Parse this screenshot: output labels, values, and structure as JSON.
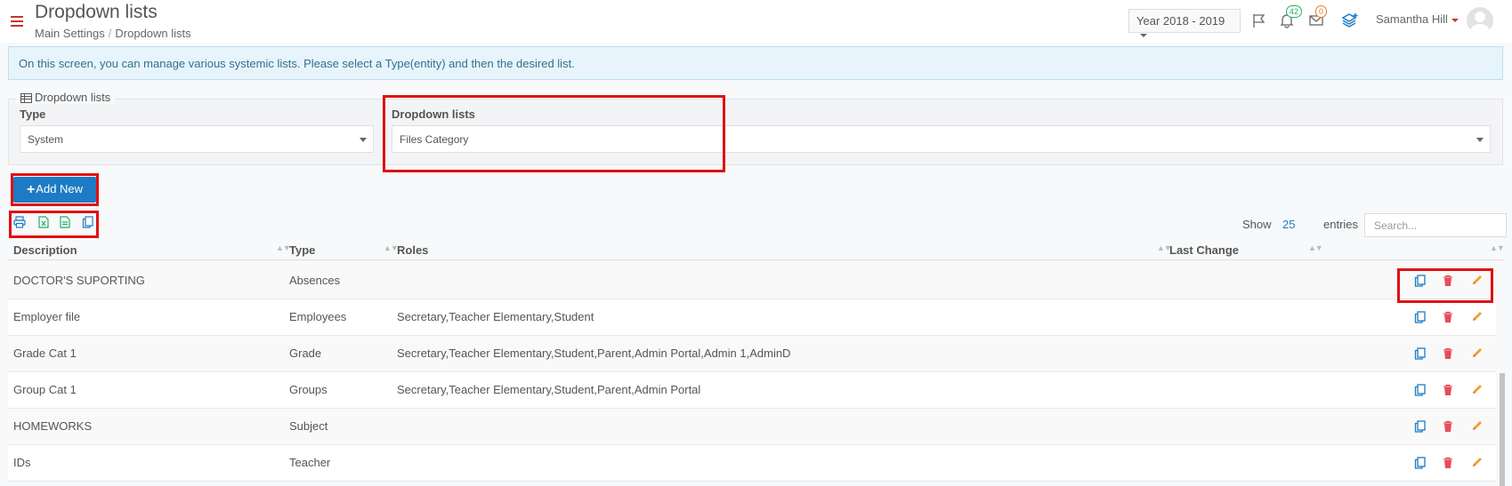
{
  "header": {
    "title": "Dropdown lists",
    "breadcrumb": [
      "Main Settings",
      "Dropdown lists"
    ],
    "year": "Year 2018 - 2019",
    "notifications_count": "42",
    "messages_count": "0",
    "user_name": "Samantha Hill"
  },
  "info_text": "On this screen, you can manage various systemic lists. Please select a Type(entity) and then the desired list.",
  "panel": {
    "legend": "Dropdown lists",
    "type_label": "Type",
    "type_value": "System",
    "list_label": "Dropdown lists",
    "list_value": "Files Category"
  },
  "add_button": "Add New",
  "table": {
    "show_label": "Show",
    "show_value": "25",
    "entries_label": "entries",
    "search_placeholder": "Search...",
    "columns": [
      "Description",
      "Type",
      "Roles",
      "Last Change"
    ],
    "rows": [
      {
        "description": "DOCTOR'S SUPORTING",
        "type": "Absences",
        "roles": "",
        "last_change": ""
      },
      {
        "description": "Employer file",
        "type": "Employees",
        "roles": "Secretary,Teacher Elementary,Student",
        "last_change": ""
      },
      {
        "description": "Grade Cat 1",
        "type": "Grade",
        "roles": "Secretary,Teacher Elementary,Student,Parent,Admin Portal,Admin 1,AdminD",
        "last_change": ""
      },
      {
        "description": "Group Cat 1",
        "type": "Groups",
        "roles": "Secretary,Teacher Elementary,Student,Parent,Admin Portal",
        "last_change": ""
      },
      {
        "description": "HOMEWORKS",
        "type": "Subject",
        "roles": "",
        "last_change": ""
      },
      {
        "description": "IDs",
        "type": "Teacher",
        "roles": "",
        "last_change": ""
      }
    ]
  },
  "colors": {
    "primary": "#1c7bc4",
    "danger": "#e74c5c",
    "edit": "#f0a030",
    "highlight": "#e01010"
  }
}
